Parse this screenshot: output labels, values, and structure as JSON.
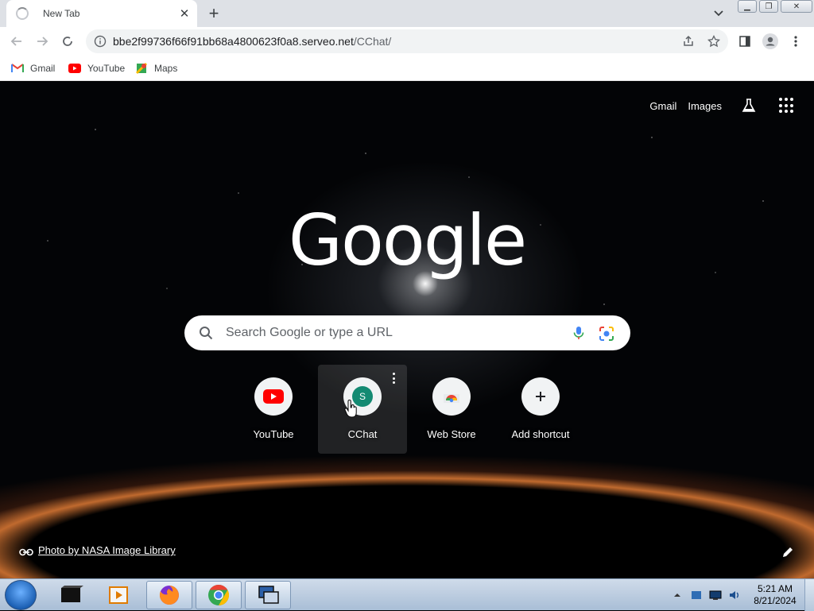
{
  "tab": {
    "title": "New Tab"
  },
  "address": {
    "host": "bbe2f99736f66f91bb68a4800623f0a8.serveo.net",
    "path": "/CChat/"
  },
  "bookmarks": [
    {
      "label": "Gmail",
      "icon": "gmail-icon"
    },
    {
      "label": "YouTube",
      "icon": "youtube-icon"
    },
    {
      "label": "Maps",
      "icon": "maps-icon"
    }
  ],
  "ntp": {
    "links": {
      "gmail": "Gmail",
      "images": "Images"
    },
    "logo": "Google",
    "search_placeholder": "Search Google or type a URL",
    "shortcuts": [
      {
        "label": "YouTube",
        "icon": "youtube-icon"
      },
      {
        "label": "CChat",
        "icon": "letter-avatar-icon",
        "letter": "S"
      },
      {
        "label": "Web Store",
        "icon": "chrome-web-store-icon"
      },
      {
        "label": "Add shortcut",
        "icon": "plus-icon"
      }
    ],
    "attribution": "Photo by NASA Image Library"
  },
  "colors": {
    "youtube": "#ff0000",
    "avatar": "#138a72",
    "accent": "#1a73e8"
  },
  "taskbar": {
    "time": "5:21 AM",
    "date": "8/21/2024"
  }
}
